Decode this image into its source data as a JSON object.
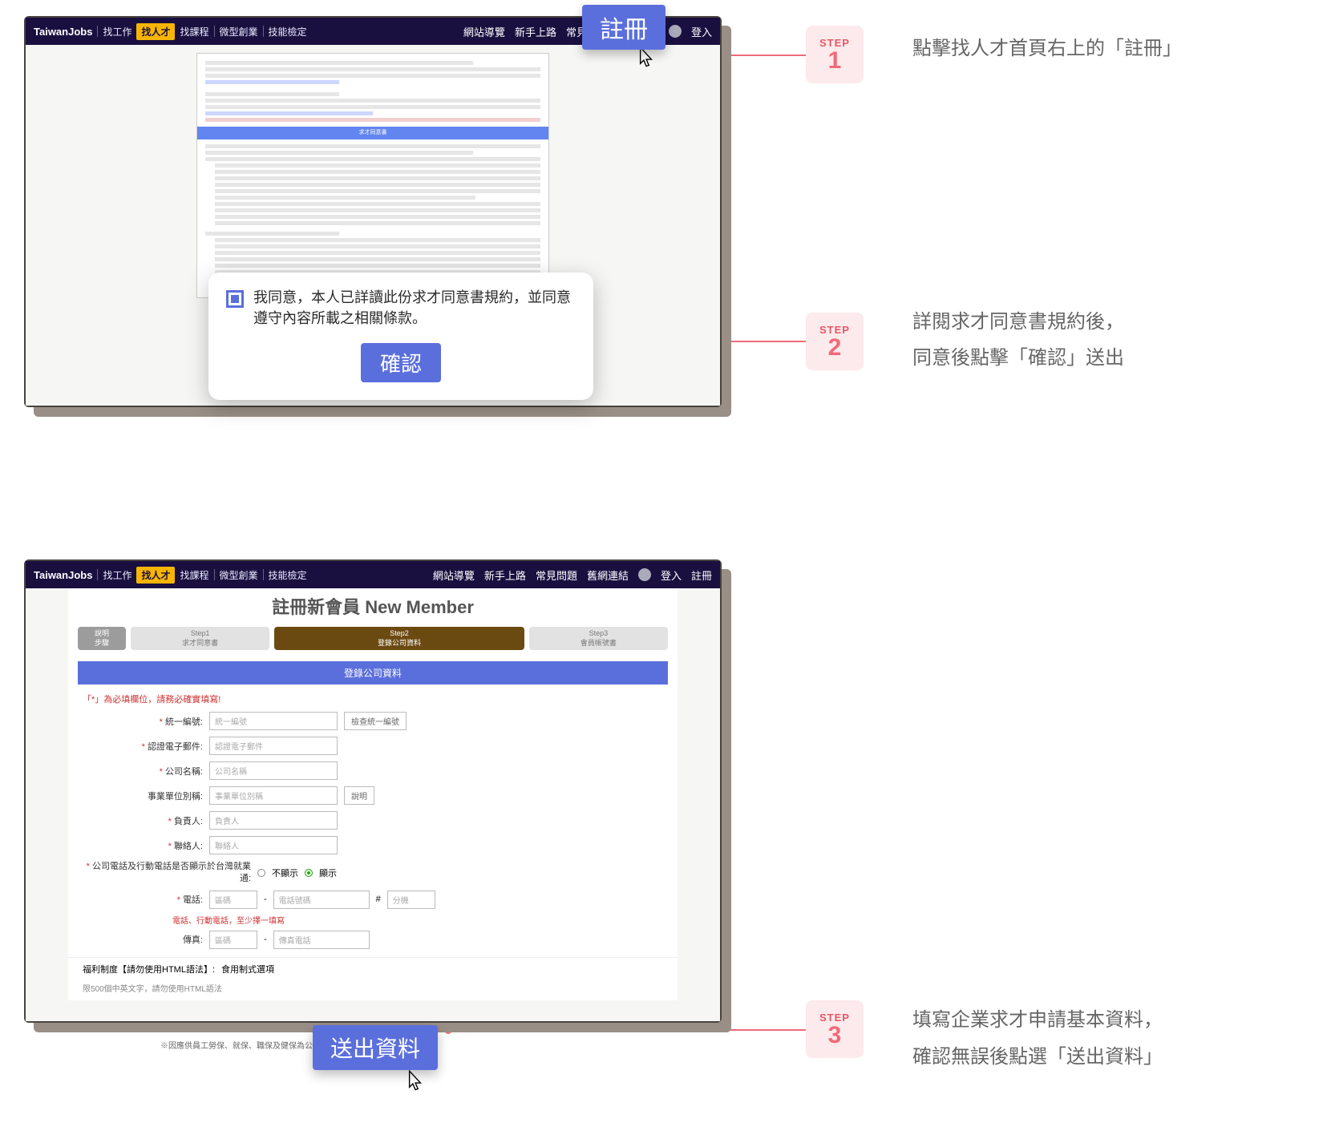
{
  "titlebar": {
    "brand": "TaiwanJobs",
    "items": [
      "找工作",
      "找人才",
      "找課程",
      "微型創業",
      "技能檢定"
    ],
    "right": [
      "網站導覽",
      "新手上路",
      "常見問題",
      "舊網連結",
      "登入",
      "註冊"
    ]
  },
  "step1": {
    "register_btn": "註冊",
    "agree_text": "我同意，本人已詳讀此份求才同意書規約，並同意遵守內容所載之相關條款。",
    "confirm": "確認",
    "terms_banner": "求才同意書",
    "badge_label": "STEP",
    "badge_num": "1",
    "desc": "點擊找人才首頁右上的「註冊」"
  },
  "step2": {
    "badge_label": "STEP",
    "badge_num": "2",
    "desc_line1": "詳閱求才同意書規約後，",
    "desc_line2": "同意後點擊「確認」送出"
  },
  "step3": {
    "badge_label": "STEP",
    "badge_num": "3",
    "desc_line1": "填寫企業求才申請基本資料，",
    "desc_line2": "確認無誤後點選「送出資料」",
    "form_title": "註冊新會員 New Member",
    "wizard": {
      "first_a": "說明",
      "first_b": "步驟",
      "s1_a": "Step1",
      "s1_b": "求才同意書",
      "s2_a": "Step2",
      "s2_b": "登錄公司資料",
      "s3_a": "Step3",
      "s3_b": "會員帳號書"
    },
    "section_banner": "登錄公司資料",
    "required_note": "「*」為必填欄位，請務必確實填寫!",
    "fields": {
      "unifiedNo_label": "統一編號:",
      "unifiedNo_ph": "統一編號",
      "checkBtn": "檢查統一編號",
      "email_label": "認證電子郵件:",
      "email_ph": "認證電子郵件",
      "name_label": "公司名稱:",
      "name_ph": "公司名稱",
      "unit_label": "事業單位別稱:",
      "unit_ph": "事業單位別稱",
      "unit_btn": "說明",
      "owner_label": "負責人:",
      "owner_ph": "負責人",
      "contact_label": "聯絡人:",
      "contact_ph": "聯絡人",
      "showPhone_label": "公司電話及行動電話是否顯示於台灣就業通:",
      "radio_hide": "不顯示",
      "radio_show": "顯示",
      "tel_label": "電話:",
      "area_ph": "區碼",
      "tel_ph": "電話號碼",
      "ext_ph": "分機",
      "tel_warn": "電話、行動電話，至少擇一填寫",
      "fax_label": "傳真:",
      "fax_ph": "傳真電話",
      "welfare_label": "福利制度【請勿使用HTML語法】:",
      "welfare_ph": "食用制式選項",
      "welfare_note": "限500個中英文字，請勿使用HTML語法",
      "footer_note": "※因應供員工勞保、就保、職保及健保為公司法定責任，故…",
      "submit": "送出資料"
    }
  }
}
